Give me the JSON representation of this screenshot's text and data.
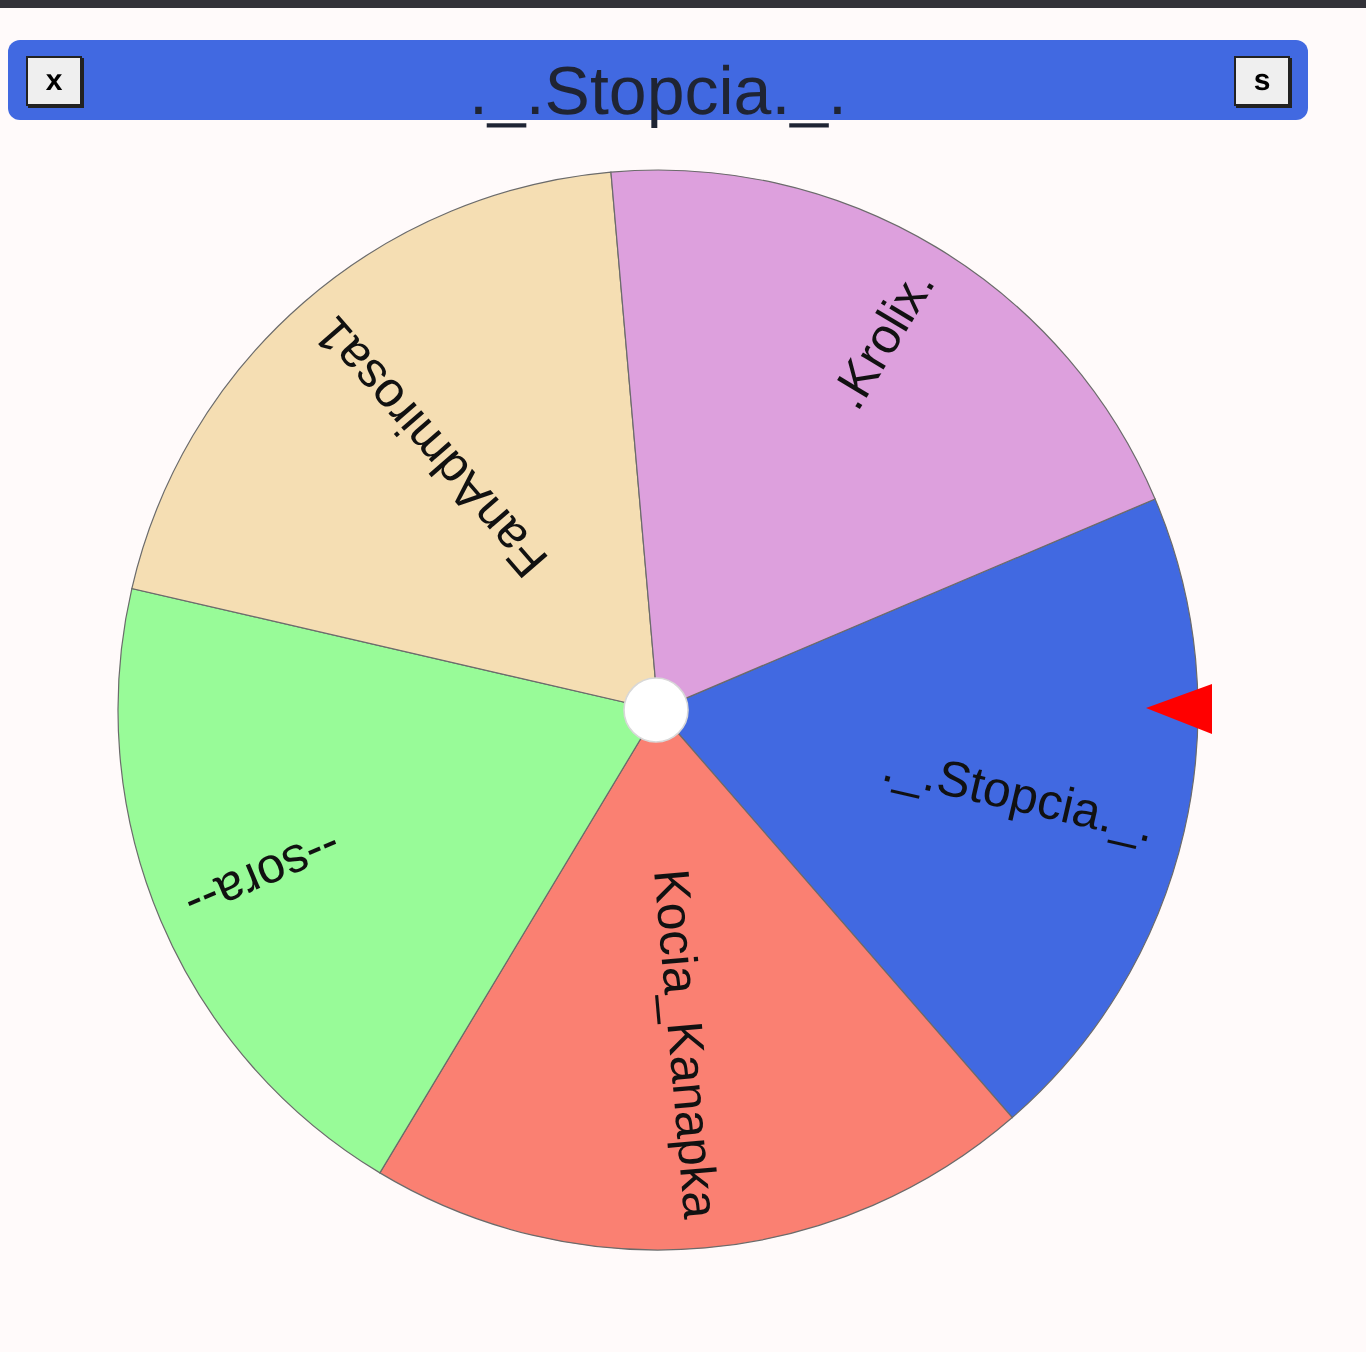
{
  "header": {
    "close_button": "x",
    "title": "._.Stopcia._.",
    "s_button": "s"
  },
  "wheel": {
    "segments": [
      {
        "label": "._.Stopcia._.",
        "color": "#4169e1"
      },
      {
        "label": "Kocia_Kanapka",
        "color": "#fa8072"
      },
      {
        "label": "--sora--",
        "color": "#98fb98"
      },
      {
        "label": "FanAdmirosa1",
        "color": "#f5deb3"
      },
      {
        "label": ".Krolix.",
        "color": "#dda0dd"
      }
    ]
  }
}
